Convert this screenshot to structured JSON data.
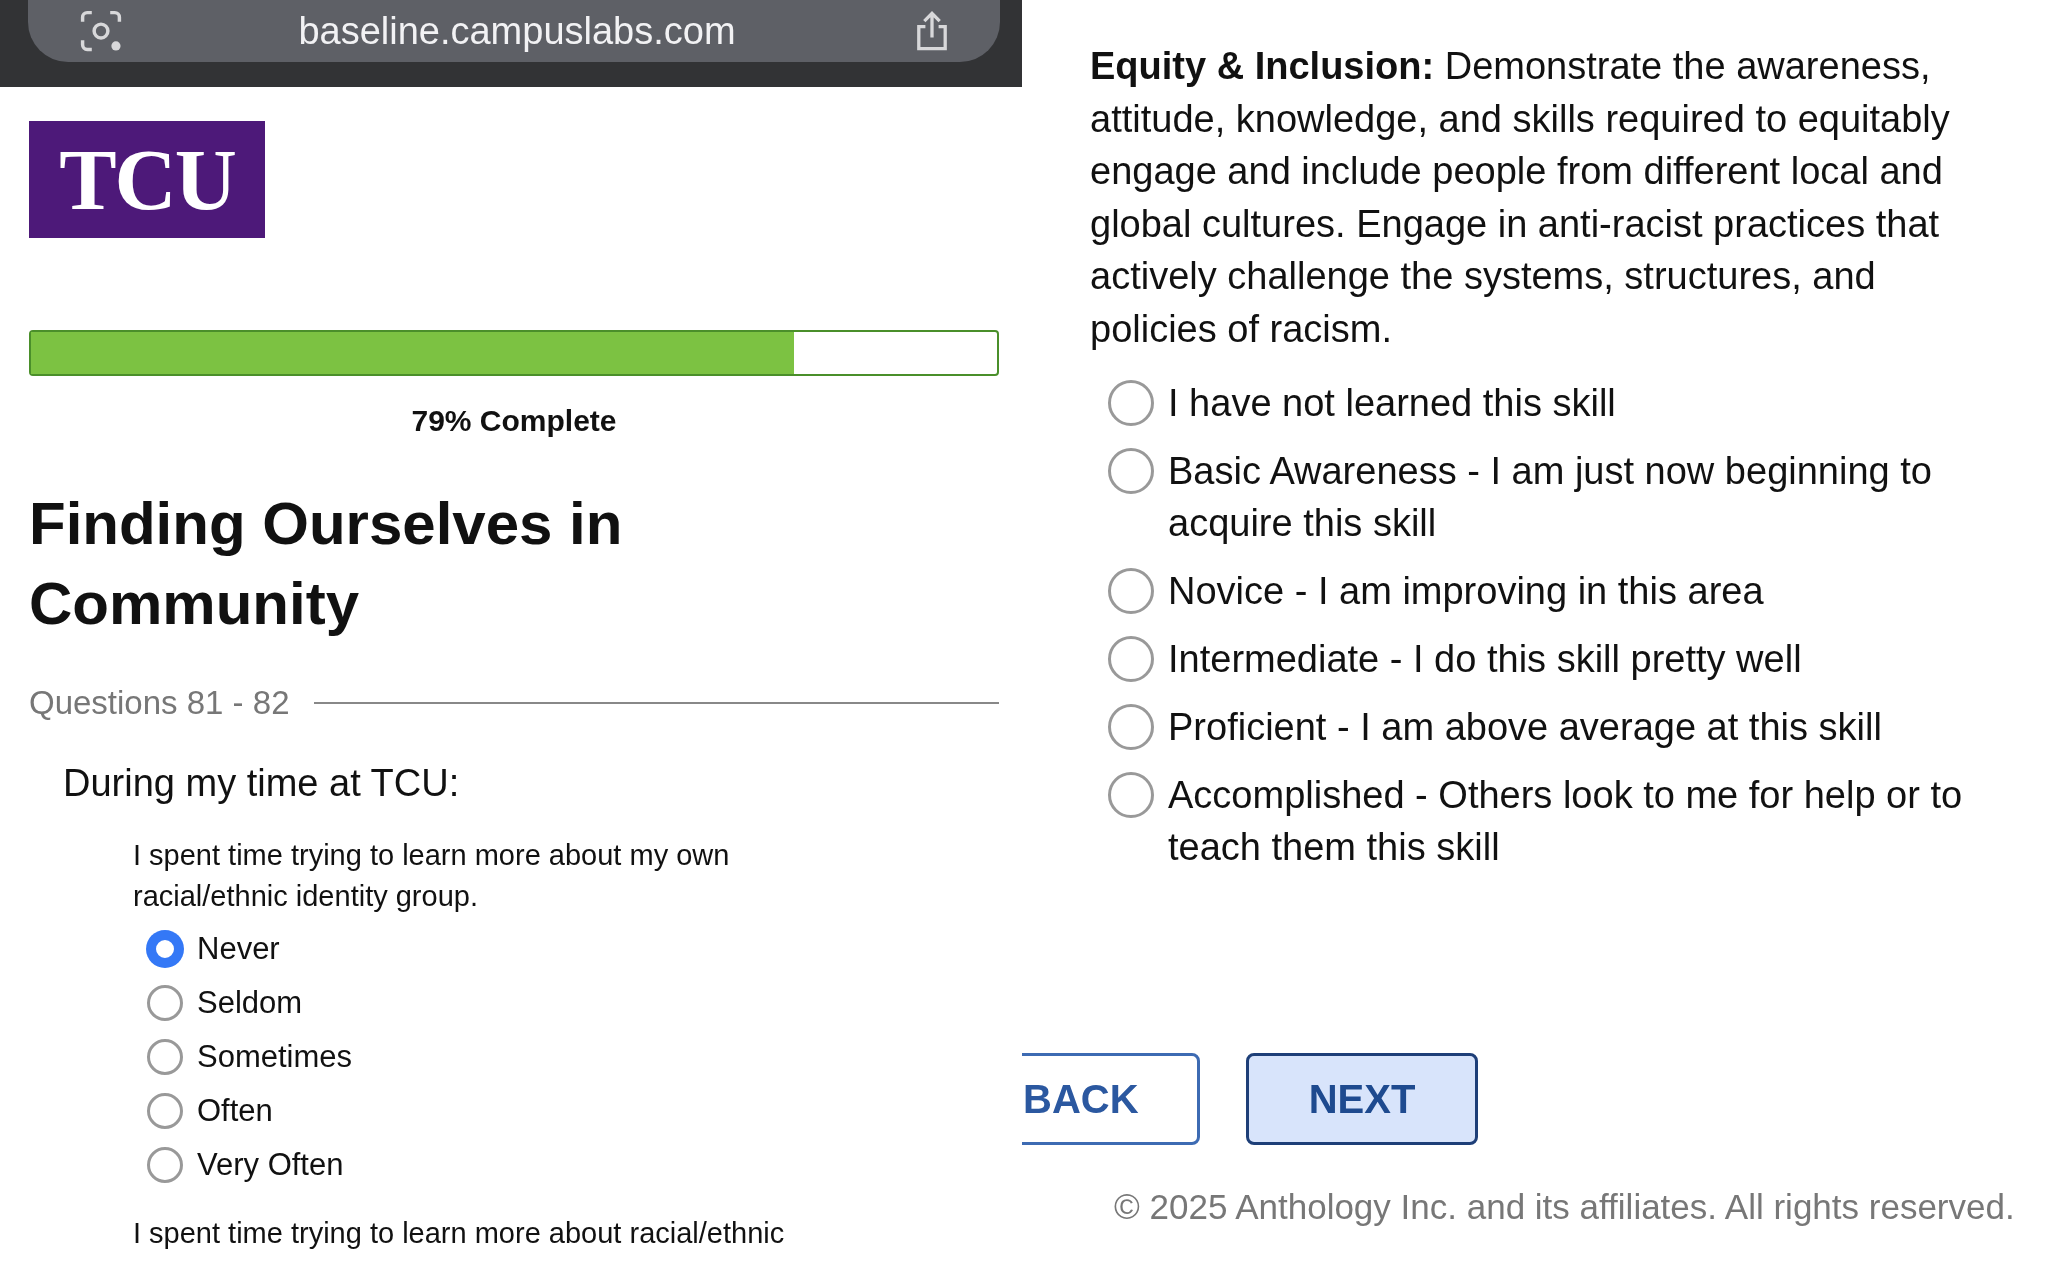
{
  "browser": {
    "url": "baseline.campuslabs.com"
  },
  "logo": {
    "text": "TCU"
  },
  "progress": {
    "level": 0.79,
    "label": "79% Complete"
  },
  "title": "Finding Ourselves in Community",
  "questions_range": "Questions 81 - 82",
  "prompt": "During my time at TCU:",
  "question": {
    "text": "I spent time trying to learn more about my own racial/ethnic identity group.",
    "options": [
      {
        "label": "Never",
        "selected": true
      },
      {
        "label": "Seldom",
        "selected": false
      },
      {
        "label": "Sometimes",
        "selected": false
      },
      {
        "label": "Often",
        "selected": false
      },
      {
        "label": "Very Often",
        "selected": false
      }
    ]
  },
  "next_question": "I spent time trying to learn more about racial/ethnic",
  "competency": {
    "text": "**Equity & Inclusion:** Demonstrate the awareness, attitude, knowledge, and skills required to equitably engage and include people from different local and global cultures. Engage in anti-racist practices that actively challenge the systems, structures, and policies of racism.",
    "options": [
      {
        "label": "I have not learned this skill",
        "selected": false
      },
      {
        "label": "Basic Awareness - I am just now beginning to acquire this skill",
        "selected": false
      },
      {
        "label": "Novice - I am improving in this area",
        "selected": false
      },
      {
        "label": "Intermediate - I do this skill pretty well",
        "selected": false
      },
      {
        "label": "Proficient - I am above average at this skill",
        "selected": false
      },
      {
        "label": "Accomplished - Others look to me for help or to teach them this skill",
        "selected": false
      }
    ]
  },
  "buttons": [
    {
      "label": "BACK",
      "kind": "secondary"
    },
    {
      "label": "NEXT",
      "kind": "primary"
    }
  ],
  "footer": "© 2025 Anthology Inc. and its affiliates. All rights reserved."
}
